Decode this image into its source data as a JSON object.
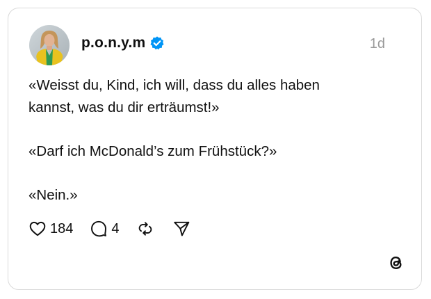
{
  "post": {
    "author": {
      "username": "p.o.n.y.m",
      "verified": true
    },
    "timestamp": "1d",
    "lines": [
      "«Weisst du, Kind, ich will, dass du alles haben",
      "kannst, was du dir erträumst!»",
      "«Darf ich McDonald’s zum Frühstück?»",
      "«Nein.»"
    ],
    "likes": "184",
    "replies": "4"
  },
  "icons": {
    "verified": "verified-check-icon",
    "like": "heart-icon",
    "reply": "comment-bubble-icon",
    "repost": "repost-icon",
    "share": "send-icon",
    "brand": "threads-logo-icon"
  },
  "colors": {
    "verified": "#0095f6",
    "text": "#101010",
    "muted": "#999999",
    "border": "#d9d9d9"
  }
}
